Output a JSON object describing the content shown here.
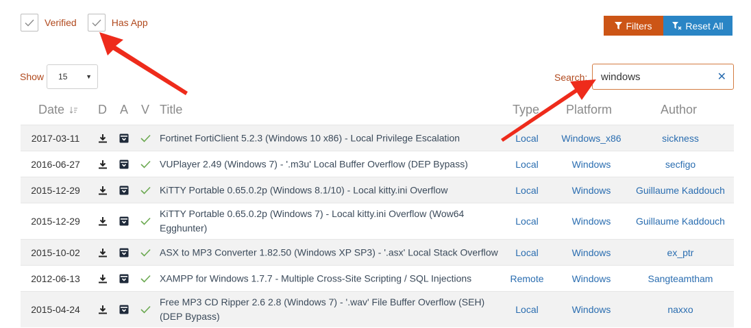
{
  "filters": {
    "verified_label": "Verified",
    "has_app_label": "Has App",
    "filters_button": "Filters",
    "reset_button": "Reset All"
  },
  "show": {
    "label": "Show",
    "value": "15"
  },
  "search": {
    "label": "Search:",
    "value": "windows"
  },
  "columns": {
    "date": "Date",
    "d": "D",
    "a": "A",
    "v": "V",
    "title": "Title",
    "type": "Type",
    "platform": "Platform",
    "author": "Author"
  },
  "rows": [
    {
      "date": "2017-03-11",
      "title": "Fortinet FortiClient 5.2.3 (Windows 10 x86) - Local Privilege Escalation",
      "type": "Local",
      "platform": "Windows_x86",
      "author": "sickness"
    },
    {
      "date": "2016-06-27",
      "title": "VUPlayer 2.49 (Windows 7) - '.m3u' Local Buffer Overflow (DEP Bypass)",
      "type": "Local",
      "platform": "Windows",
      "author": "secfigo"
    },
    {
      "date": "2015-12-29",
      "title": "KiTTY Portable 0.65.0.2p (Windows 8.1/10) - Local kitty.ini Overflow",
      "type": "Local",
      "platform": "Windows",
      "author": "Guillaume Kaddouch"
    },
    {
      "date": "2015-12-29",
      "title": "KiTTY Portable 0.65.0.2p (Windows 7) - Local kitty.ini Overflow (Wow64 Egghunter)",
      "type": "Local",
      "platform": "Windows",
      "author": "Guillaume Kaddouch"
    },
    {
      "date": "2015-10-02",
      "title": "ASX to MP3 Converter 1.82.50 (Windows XP SP3) - '.asx' Local Stack Overflow",
      "type": "Local",
      "platform": "Windows",
      "author": "ex_ptr"
    },
    {
      "date": "2012-06-13",
      "title": "XAMPP for Windows 1.7.7 - Multiple Cross-Site Scripting / SQL Injections",
      "type": "Remote",
      "platform": "Windows",
      "author": "Sangteamtham"
    },
    {
      "date": "2015-04-24",
      "title": "Free MP3 CD Ripper 2.6 2.8 (Windows 7) - '.wav' File Buffer Overflow (SEH) (DEP Bypass)",
      "type": "Local",
      "platform": "Windows",
      "author": "naxxo"
    }
  ],
  "colors": {
    "accent_orange": "#cc5516",
    "accent_blue": "#2a85c5",
    "label_orange": "#b0481c",
    "link_blue": "#2a6db0",
    "check_green": "#6aa84f",
    "arrow_red": "#ee2b1b"
  },
  "icons": [
    "check-icon",
    "filter-icon",
    "reset-filter-icon",
    "sort-icon",
    "download-icon",
    "app-icon",
    "verified-check-icon",
    "close-icon",
    "caret-down-icon"
  ]
}
